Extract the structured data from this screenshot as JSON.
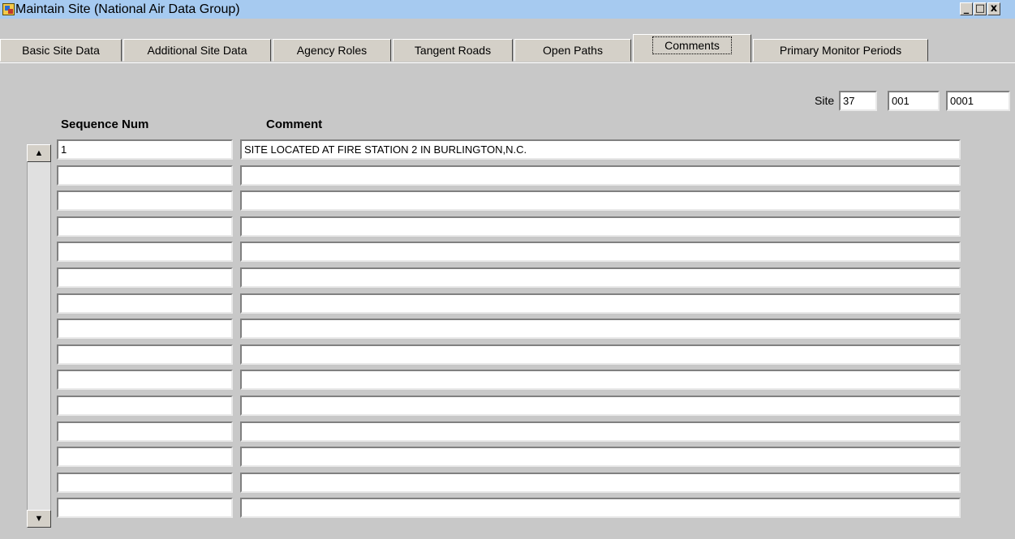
{
  "window": {
    "title": "Maintain Site (National Air Data Group)",
    "controls": {
      "minimize": "_",
      "maximize": "□",
      "close": "x"
    }
  },
  "tabs": [
    {
      "label": "Basic Site Data",
      "active": false
    },
    {
      "label": "Additional Site Data",
      "active": false
    },
    {
      "label": "Agency Roles",
      "active": false
    },
    {
      "label": "Tangent Roads",
      "active": false
    },
    {
      "label": "Open Paths",
      "active": false
    },
    {
      "label": "Comments",
      "active": true
    },
    {
      "label": "Primary Monitor Periods",
      "active": false
    }
  ],
  "site": {
    "label": "Site",
    "state": "37",
    "county": "001",
    "site_id": "0001"
  },
  "columns": {
    "sequence": "Sequence Num",
    "comment": "Comment"
  },
  "rows": [
    {
      "sequence": "1",
      "comment": "SITE LOCATED AT FIRE STATION 2 IN BURLINGTON,N.C."
    },
    {
      "sequence": "",
      "comment": ""
    },
    {
      "sequence": "",
      "comment": ""
    },
    {
      "sequence": "",
      "comment": ""
    },
    {
      "sequence": "",
      "comment": ""
    },
    {
      "sequence": "",
      "comment": ""
    },
    {
      "sequence": "",
      "comment": ""
    },
    {
      "sequence": "",
      "comment": ""
    },
    {
      "sequence": "",
      "comment": ""
    },
    {
      "sequence": "",
      "comment": ""
    },
    {
      "sequence": "",
      "comment": ""
    },
    {
      "sequence": "",
      "comment": ""
    },
    {
      "sequence": "",
      "comment": ""
    },
    {
      "sequence": "",
      "comment": ""
    },
    {
      "sequence": "",
      "comment": ""
    }
  ],
  "scrollbar": {
    "up": "▲",
    "down": "▼"
  },
  "colors": {
    "titlebar": "#a6caf0",
    "background": "#c8c8c8"
  }
}
